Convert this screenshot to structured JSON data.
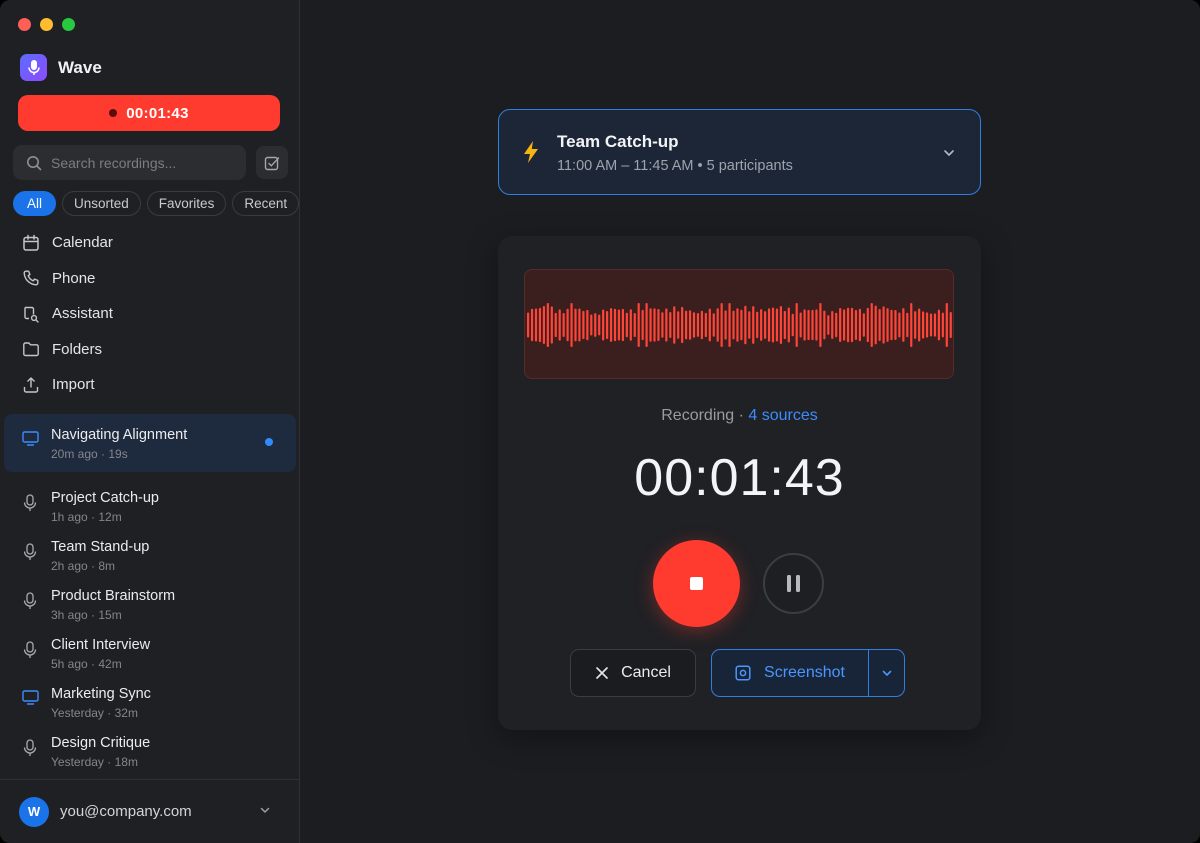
{
  "app": {
    "name": "Wave",
    "logo_icon": "microphone-icon"
  },
  "window_controls": [
    "close",
    "minimize",
    "zoom"
  ],
  "sidebar": {
    "recording_timer": "00:01:43",
    "search": {
      "placeholder": "Search recordings..."
    },
    "filters": [
      {
        "label": "All",
        "active": true
      },
      {
        "label": "Unsorted",
        "active": false
      },
      {
        "label": "Favorites",
        "active": false
      },
      {
        "label": "Recent",
        "active": false
      }
    ],
    "nav": [
      {
        "label": "Calendar",
        "icon": "calendar-icon"
      },
      {
        "label": "Phone",
        "icon": "phone-icon"
      },
      {
        "label": "Assistant",
        "icon": "assistant-icon"
      },
      {
        "label": "Folders",
        "icon": "folder-icon"
      },
      {
        "label": "Import",
        "icon": "import-icon"
      }
    ],
    "recordings": [
      {
        "title": "Navigating Alignment",
        "meta": "20m ago · 19s",
        "icon": "monitor-icon",
        "selected": true,
        "unread": true
      },
      {
        "title": "Project Catch-up",
        "meta": "1h ago · 12m",
        "icon": "microphone-icon"
      },
      {
        "title": "Team Stand-up",
        "meta": "2h ago · 8m",
        "icon": "microphone-icon"
      },
      {
        "title": "Product Brainstorm",
        "meta": "3h ago · 15m",
        "icon": "microphone-icon"
      },
      {
        "title": "Client Interview",
        "meta": "5h ago · 42m",
        "icon": "microphone-icon"
      },
      {
        "title": "Marketing Sync",
        "meta": "Yesterday · 32m",
        "icon": "monitor-icon"
      },
      {
        "title": "Design Critique",
        "meta": "Yesterday · 18m",
        "icon": "microphone-icon"
      }
    ],
    "account": {
      "avatar_initial": "W",
      "email": "you@company.com"
    }
  },
  "meeting": {
    "title": "Team Catch-up",
    "subtitle": "11:00 AM – 11:45 AM • 5 participants",
    "icon": "lightning-icon"
  },
  "recorder": {
    "status_label": "Recording · ",
    "sources_label": "4 sources",
    "timer": "00:01:43",
    "cancel_label": "Cancel",
    "screenshot_label": "Screenshot"
  },
  "colors": {
    "accent": "#1a73e8",
    "record_red": "#ff3b30",
    "waveform": "#ff4438"
  }
}
